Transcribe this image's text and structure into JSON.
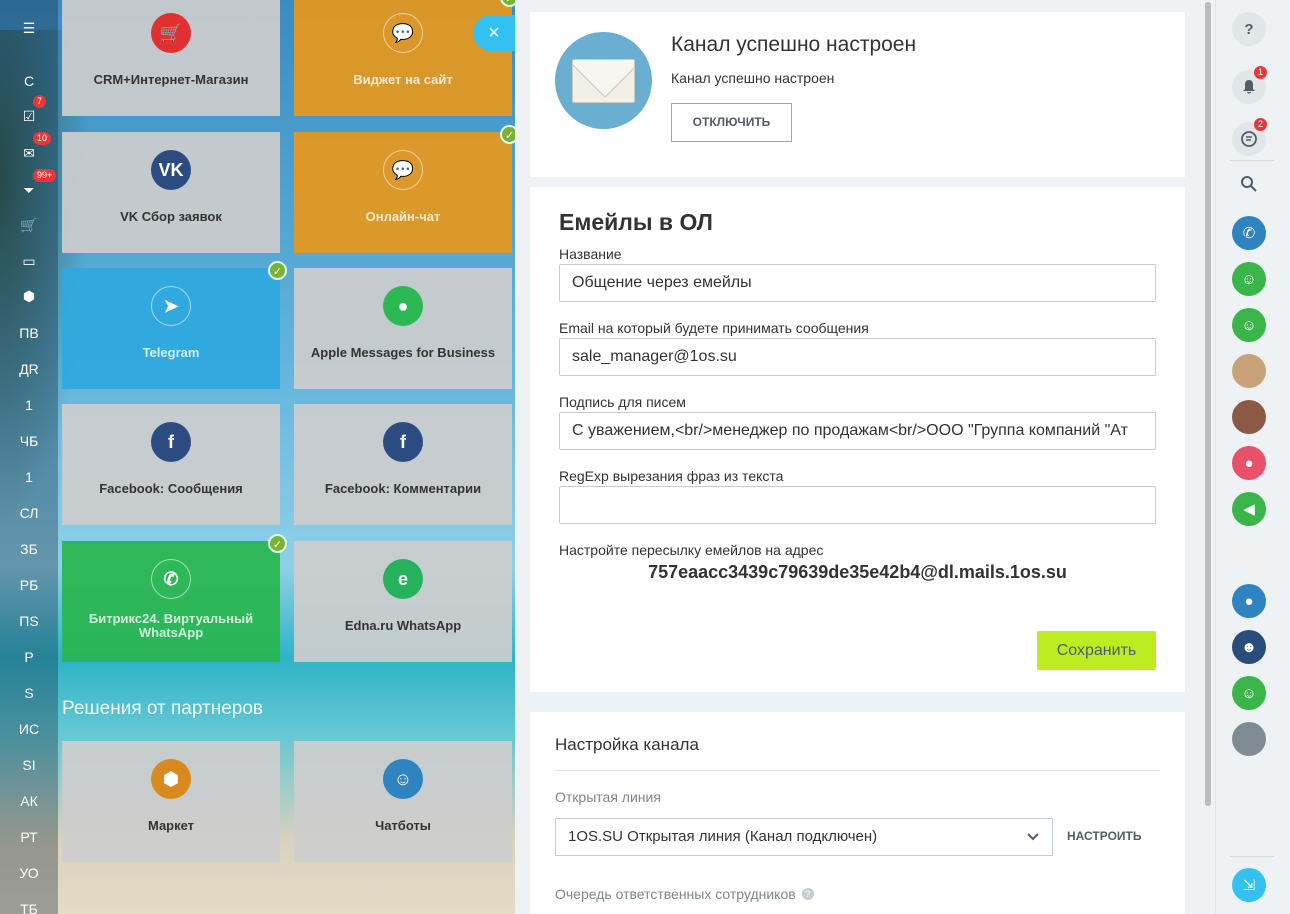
{
  "left_nav": {
    "items": [
      {
        "label": "☰",
        "badge": ""
      },
      {
        "label": "С",
        "badge": ""
      },
      {
        "label": "☑",
        "badge": "7"
      },
      {
        "label": "✉",
        "badge": "10"
      },
      {
        "label": "⏷",
        "badge": "99+"
      },
      {
        "label": "🛒",
        "badge": ""
      },
      {
        "label": "▭",
        "badge": ""
      },
      {
        "label": "⬢",
        "badge": ""
      },
      {
        "label": "ПВ",
        "badge": ""
      },
      {
        "label": "ДR",
        "badge": ""
      },
      {
        "label": "1",
        "badge": ""
      },
      {
        "label": "ЧБ",
        "badge": ""
      },
      {
        "label": "1",
        "badge": ""
      },
      {
        "label": "СЛ",
        "badge": ""
      },
      {
        "label": "ЗБ",
        "badge": ""
      },
      {
        "label": "РБ",
        "badge": ""
      },
      {
        "label": "ПS",
        "badge": ""
      },
      {
        "label": "Р",
        "badge": ""
      },
      {
        "label": "S",
        "badge": ""
      },
      {
        "label": "ИС",
        "badge": ""
      },
      {
        "label": "SI",
        "badge": ""
      },
      {
        "label": "АК",
        "badge": ""
      },
      {
        "label": "РТ",
        "badge": ""
      },
      {
        "label": "УО",
        "badge": ""
      },
      {
        "label": "ТБ",
        "badge": ""
      }
    ]
  },
  "tiles": [
    {
      "label": "CRM+Интернет-Магазин",
      "icon": "cart-icon",
      "glyph": "🛒",
      "color": "#e1302f",
      "style": "gray"
    },
    {
      "label": "Виджет на сайт",
      "icon": "chat-icon",
      "glyph": "💬",
      "color": "",
      "style": "orange"
    },
    {
      "label": "VK Сбор заявок",
      "icon": "vk-icon",
      "glyph": "VK",
      "color": "#2c4b80",
      "style": "gray"
    },
    {
      "label": "Онлайн-чат",
      "icon": "chat-icon",
      "glyph": "💬",
      "color": "",
      "style": "orange"
    },
    {
      "label": "Telegram",
      "icon": "telegram-icon",
      "glyph": "➤",
      "color": "",
      "style": "blue"
    },
    {
      "label": "Apple Messages for Business",
      "icon": "message-bubble-icon",
      "glyph": "●",
      "color": "#2db853",
      "style": "gray"
    },
    {
      "label": "Facebook: Сообщения",
      "icon": "facebook-icon",
      "glyph": "f",
      "color": "#2c4b80",
      "style": "gray"
    },
    {
      "label": "Facebook: Комментарии",
      "icon": "facebook-comments-icon",
      "glyph": "f",
      "color": "#2c4b80",
      "style": "gray"
    },
    {
      "label": "Битрикс24. Виртуальный WhatsApp",
      "icon": "whatsapp-icon",
      "glyph": "✆",
      "color": "",
      "style": "green"
    },
    {
      "label": "Edna.ru WhatsApp",
      "icon": "edna-icon",
      "glyph": "e",
      "color": "#26b25a",
      "style": "gray"
    }
  ],
  "partners": {
    "title": "Решения от партнеров",
    "tiles": [
      {
        "label": "Маркет",
        "icon": "box-icon",
        "glyph": "⬢",
        "color": "#d98a1e"
      },
      {
        "label": "Чатботы",
        "icon": "bot-icon",
        "glyph": "☺",
        "color": "#2f83c0"
      }
    ]
  },
  "close_button": "×",
  "status": {
    "title": "Канал успешно настроен",
    "subtitle": "Канал успешно настроен",
    "disconnect_label": "ОТКЛЮЧИТЬ"
  },
  "form": {
    "title": "Емейлы в ОЛ",
    "fields": [
      {
        "label": "Название",
        "value": "Общение через емейлы"
      },
      {
        "label": "Email на который будете принимать сообщения",
        "value": "sale_manager@1os.su"
      },
      {
        "label": "Подпись для писем",
        "value": "С уважением,<br/>менеджер по продажам<br/>ООО \"Группа компаний \"Ат"
      },
      {
        "label": "RegExp вырезания фраз из текста",
        "value": ""
      }
    ],
    "forward_label": "Настройте пересылку емейлов на адрес",
    "forward_address": "757eaacc3439c79639de35e42b4@dl.mails.1os.su",
    "save_label": "Сохранить"
  },
  "channel_settings": {
    "title": "Настройка канала",
    "open_line_label": "Открытая линия",
    "open_line_value": "1OS.SU Открытая линия (Канал подключен)",
    "configure_label": "НАСТРОИТЬ",
    "queue_label": "Очередь ответственных сотрудников"
  },
  "right_bar": {
    "help": "?",
    "notifications_badge": "1",
    "chats_badge": "2"
  },
  "colors": {
    "accent_blue": "#33c1f1",
    "save_green": "#bbed21",
    "badge_red": "#e6383a",
    "check_green": "#7ab234"
  }
}
